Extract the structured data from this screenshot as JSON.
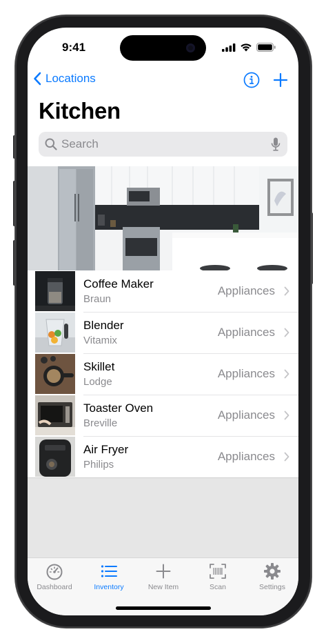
{
  "status_bar": {
    "time": "9:41"
  },
  "nav": {
    "back_label": "Locations",
    "title": "Kitchen"
  },
  "search": {
    "placeholder": "Search"
  },
  "items": [
    {
      "name": "Coffee Maker",
      "brand": "Braun",
      "category": "Appliances"
    },
    {
      "name": "Blender",
      "brand": "Vitamix",
      "category": "Appliances"
    },
    {
      "name": "Skillet",
      "brand": "Lodge",
      "category": "Appliances"
    },
    {
      "name": "Toaster Oven",
      "brand": "Breville",
      "category": "Appliances"
    },
    {
      "name": "Air Fryer",
      "brand": "Philips",
      "category": "Appliances"
    }
  ],
  "tabs": [
    {
      "label": "Dashboard",
      "icon": "speedometer-icon",
      "active": false
    },
    {
      "label": "Inventory",
      "icon": "list-icon",
      "active": true
    },
    {
      "label": "New Item",
      "icon": "plus-icon",
      "active": false
    },
    {
      "label": "Scan",
      "icon": "barcode-scan-icon",
      "active": false
    },
    {
      "label": "Settings",
      "icon": "gear-icon",
      "active": false
    }
  ],
  "colors": {
    "accent": "#0a7aff",
    "secondary_text": "#8a8a8e",
    "search_bg": "#e9e9eb"
  }
}
